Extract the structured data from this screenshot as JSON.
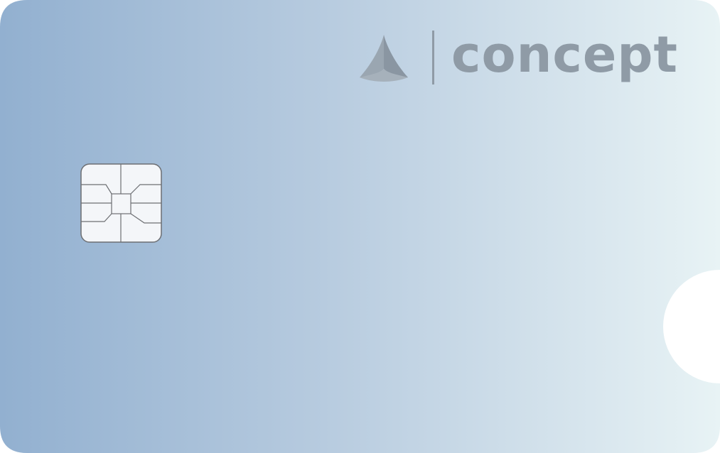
{
  "brand": {
    "name": "concept",
    "logo_icon": "tri-blade-logo-icon",
    "text_color": "#8f9ba6"
  },
  "card": {
    "gradient_start": "#92b0d0",
    "gradient_end": "#e8f3f5",
    "chip_icon": "emv-chip-icon",
    "chip_fill": "#f4f6f9",
    "chip_stroke": "#6d6f73"
  }
}
